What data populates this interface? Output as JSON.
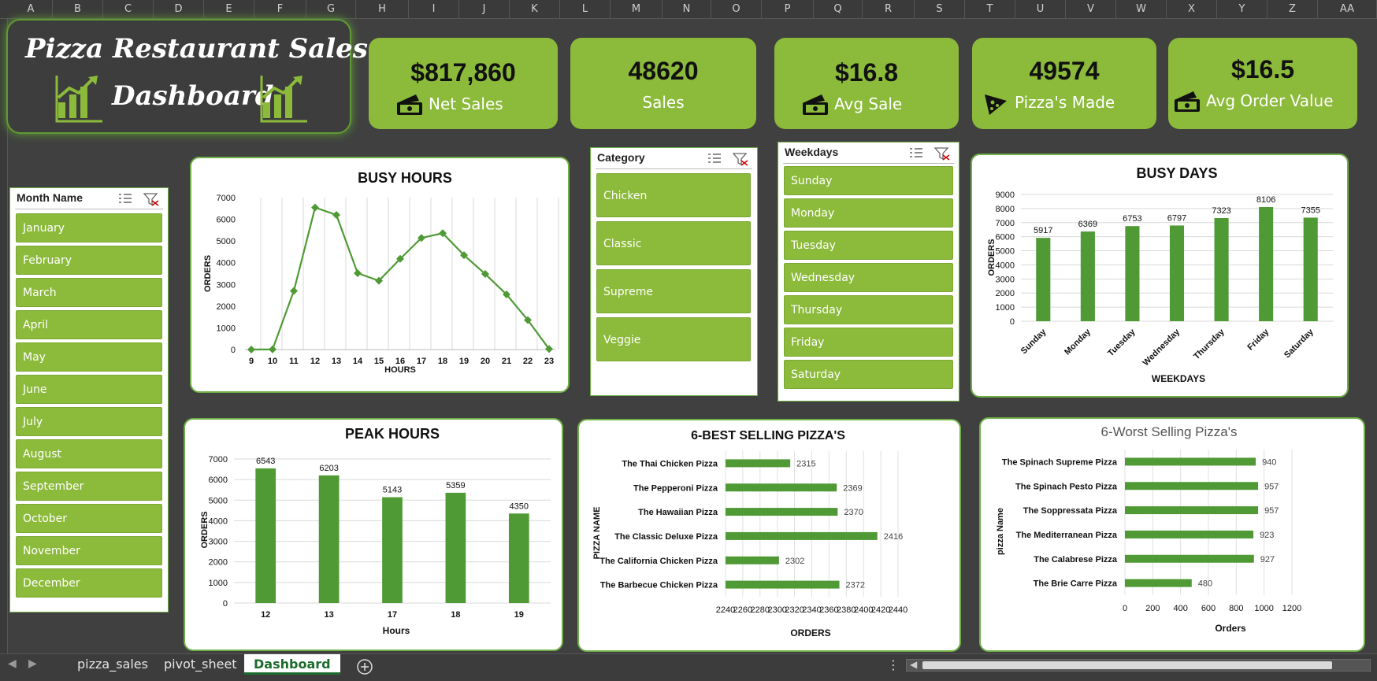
{
  "columns": [
    "A",
    "B",
    "C",
    "D",
    "E",
    "F",
    "G",
    "H",
    "I",
    "J",
    "K",
    "L",
    "M",
    "N",
    "O",
    "P",
    "Q",
    "R",
    "S",
    "T",
    "U",
    "V",
    "W",
    "X",
    "Y",
    "Z",
    "AA"
  ],
  "title": {
    "line1": "Pizza Restaurant Sales",
    "line2": "Dashboard"
  },
  "kpis": [
    {
      "value": "$817,860",
      "label": "Net Sales",
      "icon": "money-icon"
    },
    {
      "value": "48620",
      "label": "Sales",
      "icon": ""
    },
    {
      "value": "$16.8",
      "label": "Avg Sale",
      "icon": "money-icon"
    },
    {
      "value": "49574",
      "label": "Pizza's Made",
      "icon": "pizza-icon"
    },
    {
      "value": "$16.5",
      "label": "Avg Order Value",
      "icon": "money-icon"
    }
  ],
  "slicers": {
    "month": {
      "title": "Month Name",
      "items": [
        "January",
        "February",
        "March",
        "April",
        "May",
        "June",
        "July",
        "August",
        "September",
        "October",
        "November",
        "December"
      ]
    },
    "category": {
      "title": "Category",
      "items": [
        "Chicken",
        "Classic",
        "Supreme",
        "Veggie"
      ]
    },
    "weekdays": {
      "title": "Weekdays",
      "items": [
        "Sunday",
        "Monday",
        "Tuesday",
        "Wednesday",
        "Thursday",
        "Friday",
        "Saturday"
      ]
    }
  },
  "chart_data": [
    {
      "id": "busy_hours",
      "type": "line",
      "title": "BUSY HOURS",
      "xlabel": "HOURS",
      "ylabel": "ORDERS",
      "x": [
        "9",
        "10",
        "11",
        "12",
        "13",
        "14",
        "15",
        "16",
        "17",
        "18",
        "19",
        "20",
        "21",
        "22",
        "23"
      ],
      "values": [
        1,
        8,
        2700,
        6543,
        6203,
        3520,
        3170,
        4180,
        5143,
        5359,
        4350,
        3480,
        2540,
        1360,
        25
      ],
      "ylim": [
        0,
        7000
      ],
      "yticks": [
        0,
        1000,
        2000,
        3000,
        4000,
        5000,
        6000,
        7000
      ],
      "color": "#4f9a35",
      "grid": true
    },
    {
      "id": "busy_days",
      "type": "bar",
      "title": "BUSY DAYS",
      "xlabel": "WEEKDAYS",
      "ylabel": "ORDERS",
      "categories": [
        "Sunday",
        "Monday",
        "Tuesday",
        "Wednesday",
        "Thursday",
        "Friday",
        "Saturday"
      ],
      "values": [
        5917,
        6369,
        6753,
        6797,
        7323,
        8106,
        7355
      ],
      "ylim": [
        0,
        9000
      ],
      "yticks": [
        0,
        1000,
        2000,
        3000,
        4000,
        5000,
        6000,
        7000,
        8000,
        9000
      ],
      "color": "#4f9a35"
    },
    {
      "id": "peak_hours",
      "type": "bar",
      "title": "PEAK HOURS",
      "xlabel": "Hours",
      "ylabel": "ORDERS",
      "categories": [
        "12",
        "13",
        "17",
        "18",
        "19"
      ],
      "values": [
        6543,
        6203,
        5143,
        5359,
        4350
      ],
      "ylim": [
        0,
        7000
      ],
      "yticks": [
        0,
        1000,
        2000,
        3000,
        4000,
        5000,
        6000,
        7000
      ],
      "color": "#4f9a35"
    },
    {
      "id": "best_selling",
      "type": "bar",
      "orientation": "horizontal",
      "title": "6-BEST SELLING PIZZA'S",
      "xlabel": "ORDERS",
      "ylabel": "PIZZA NAME",
      "categories": [
        "The Thai Chicken Pizza",
        "The Pepperoni Pizza",
        "The Hawaiian Pizza",
        "The Classic Deluxe Pizza",
        "The California Chicken Pizza",
        "The Barbecue Chicken Pizza"
      ],
      "values": [
        2315,
        2369,
        2370,
        2416,
        2302,
        2372
      ],
      "xlim": [
        2240,
        2440
      ],
      "xticks": [
        2240,
        2260,
        2280,
        2300,
        2320,
        2340,
        2360,
        2380,
        2400,
        2420,
        2440
      ],
      "color": "#4f9a35"
    },
    {
      "id": "worst_selling",
      "type": "bar",
      "orientation": "horizontal",
      "title": "6-Worst Selling Pizza's",
      "xlabel": "Orders",
      "ylabel": "pizza Name",
      "categories": [
        "The Spinach Supreme Pizza",
        "The Spinach Pesto Pizza",
        "The Soppressata Pizza",
        "The Mediterranean Pizza",
        "The Calabrese Pizza",
        "The Brie Carre Pizza"
      ],
      "values": [
        940,
        957,
        957,
        923,
        927,
        480
      ],
      "xlim": [
        0,
        1200
      ],
      "xticks": [
        0,
        200,
        400,
        600,
        800,
        1000,
        1200
      ],
      "color": "#4f9a35"
    }
  ],
  "tabs": [
    "pizza_sales",
    "pivot_sheet",
    "Dashboard"
  ],
  "active_tab": "Dashboard",
  "colors": {
    "accent": "#8cba3a",
    "bar": "#4f9a35",
    "background": "#404040"
  }
}
